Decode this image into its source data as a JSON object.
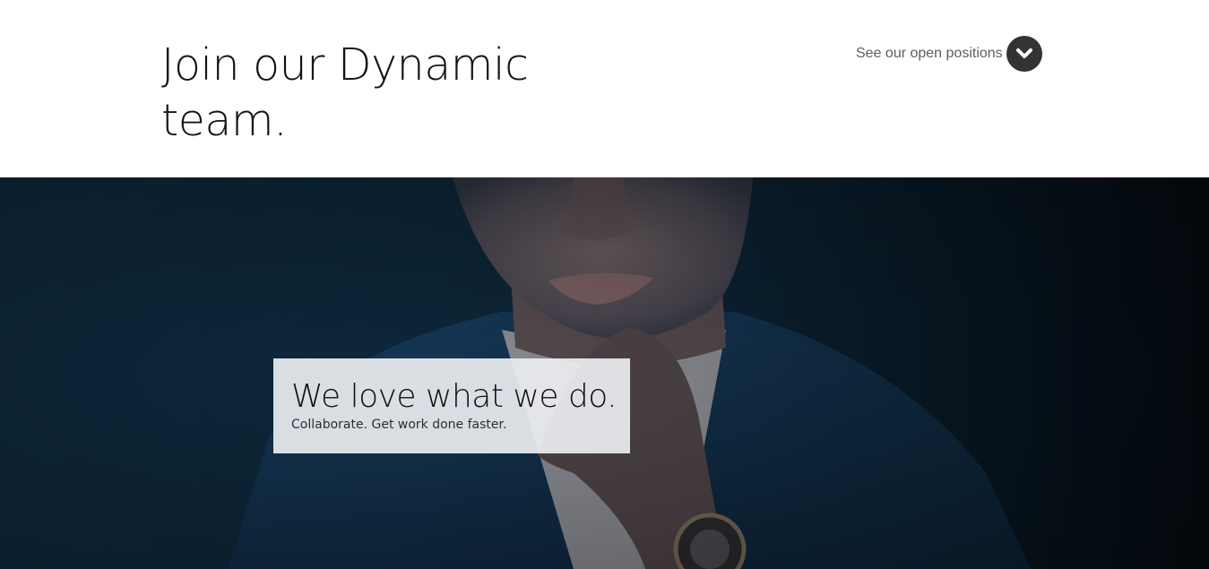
{
  "header": {
    "title": "Join our Dynamic team.",
    "open_positions_label": "See our open positions",
    "open_positions_icon": "chevron-down-icon",
    "icon_bg_color": "#333333"
  },
  "hero": {
    "heading": "We love what we do.",
    "subtext": "Collaborate. Get work done faster.",
    "background_color": "#0d2739"
  }
}
